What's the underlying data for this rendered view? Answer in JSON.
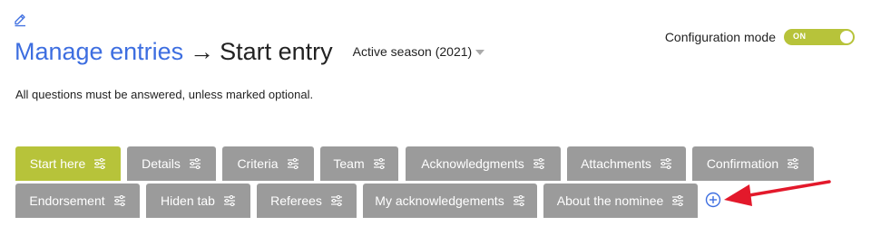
{
  "header": {
    "breadcrumb_link": "Manage entries",
    "breadcrumb_separator": "→",
    "breadcrumb_current": "Start entry",
    "season_selector": "Active season (2021)"
  },
  "config": {
    "label": "Configuration mode",
    "toggle_state": "ON",
    "toggle_color": "#b7c33a"
  },
  "instructions": "All questions must be answered, unless marked optional.",
  "tabs": [
    {
      "label": "Start here",
      "active": true
    },
    {
      "label": "Details"
    },
    {
      "label": "Criteria"
    },
    {
      "label": "Team"
    },
    {
      "label": "Acknowledgments"
    },
    {
      "label": "Attachments"
    },
    {
      "label": "Confirmation"
    },
    {
      "label": "Endorsement"
    },
    {
      "label": "Hiden tab"
    },
    {
      "label": "Referees"
    },
    {
      "label": "My acknowledgements"
    },
    {
      "label": "About the nominee"
    }
  ],
  "icons": {
    "edit": "pencil-icon",
    "tab_settings": "sliders-icon",
    "add_tab": "plus-circle-icon",
    "annotation": "red-arrow"
  },
  "colors": {
    "link": "#3d6ee0",
    "active_tab": "#b7c33a",
    "tab": "#9b9b9b",
    "annotation_arrow": "#e3192b"
  }
}
